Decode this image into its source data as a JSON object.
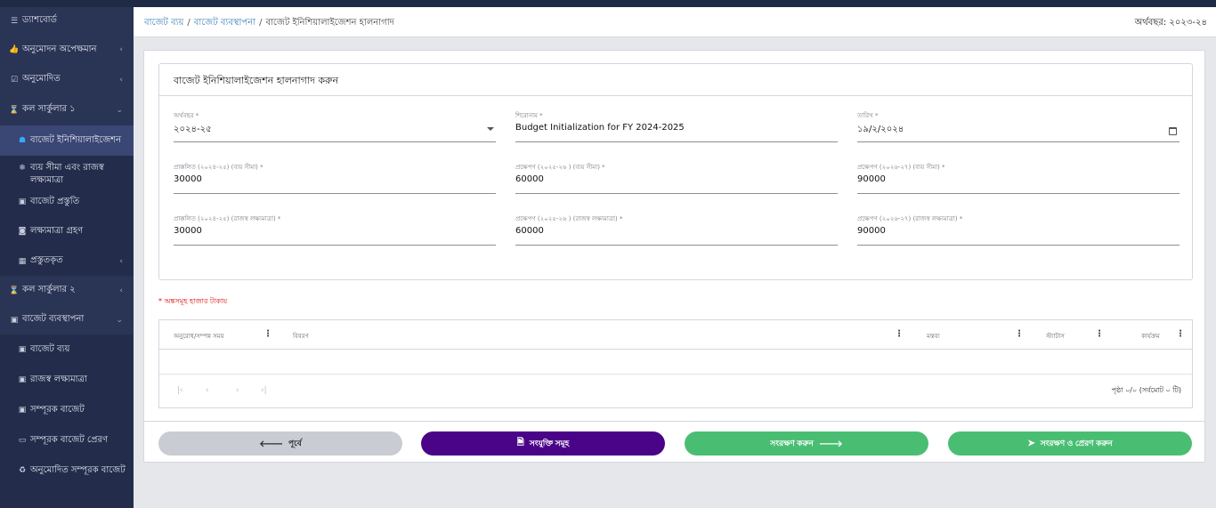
{
  "sidebar": {
    "items": [
      {
        "label": "ড্যাশবোর্ড",
        "icon": "list-icon"
      },
      {
        "label": "অনুমোদন অপেক্ষমান",
        "icon": "thumbs-up-icon"
      },
      {
        "label": "অনুমোদিত",
        "icon": "check-square-icon"
      },
      {
        "label": "কল সার্কুলার ১",
        "icon": "hourglass-icon"
      },
      {
        "label": "বাজেট ইনিশিয়ালাইজেশন",
        "icon": "inbox-icon"
      },
      {
        "label": "ব্যয় সীমা এবং রাজস্ব লক্ষ্যমাত্রা",
        "icon": "snowflake-icon"
      },
      {
        "label": "বাজেট প্রস্তুতি",
        "icon": "briefcase-icon"
      },
      {
        "label": "লক্ষ্যমাত্রা গ্রহণ",
        "icon": "money-icon"
      },
      {
        "label": "প্রস্তুতকৃত",
        "icon": "table-icon"
      },
      {
        "label": "কল সার্কুলার ২",
        "icon": "hourglass-icon"
      },
      {
        "label": "বাজেট ব্যবস্থাপনা",
        "icon": "briefcase-icon"
      },
      {
        "label": "বাজেট ব্যয়",
        "icon": "briefcase-icon"
      },
      {
        "label": "রাজস্ব লক্ষ্যমাত্রা",
        "icon": "briefcase-icon"
      },
      {
        "label": "সম্পূরক বাজেট",
        "icon": "briefcase-icon"
      },
      {
        "label": "সম্পূরক বাজেট প্রেরণ",
        "icon": "credit-card-icon"
      },
      {
        "label": "অনুমোদিত সম্পূরক বাজেট",
        "icon": "recycle-icon"
      }
    ]
  },
  "header": {
    "breadcrumb": [
      "বাজেট ব্যয়",
      "বাজেট ব্যবস্থাপনা",
      "বাজেট ইনিশিয়ালাইজেশন হালনাগাদ"
    ],
    "fiscal_year": "অর্থবছর: ২০২৩-২৪"
  },
  "form": {
    "title": "বাজেট ইনিশিয়ালাইজেশন হালনাগাদ করুন",
    "fields": [
      {
        "label": "অর্থবছর *",
        "value": "২০২৪-২৫"
      },
      {
        "label": "শিরোনাম *",
        "value": "Budget Initialization for FY 2024-2025"
      },
      {
        "label": "তারিখ *",
        "value": "১৯/২/২০২৪"
      },
      {
        "label": "প্রাক্কলিত (২০২৪-২৫) (ব্যয় সীমা) *",
        "value": "30000"
      },
      {
        "label": "প্রক্ষেপণ (২০২৫-২৬ ) (ব্যয় সীমা) *",
        "value": "60000"
      },
      {
        "label": "প্রক্ষেপণ (২০২৬-২৭) (ব্যয় সীমা) *",
        "value": "90000"
      },
      {
        "label": "প্রাক্কলিত (২০২৪-২৫) (রাজস্ব লক্ষ্যমাত্রা) *",
        "value": "30000"
      },
      {
        "label": "প্রক্ষেপণ (২০২৫-২৬ ) (রাজস্ব লক্ষ্যমাত্রা) *",
        "value": "60000"
      },
      {
        "label": "প্রক্ষেপণ (২০২৬-২৭) (রাজস্ব লক্ষ্যমাত্রা) *",
        "value": "90000"
      }
    ]
  },
  "note": "* অঙ্কসমূহ হাজার টাকায়",
  "table": {
    "columns": [
      "অনুরোধ/সম্পন্ন সময়",
      "বিবরণ",
      "মন্তব্য",
      "স্ট্যাটাস",
      "কার্যক্রম"
    ],
    "pagination": {
      "first": "|‹",
      "prev": "‹",
      "next": "›",
      "last": "›|",
      "info": "পৃষ্ঠা ০/০ (সর্বমোট ০ টি)"
    }
  },
  "buttons": {
    "prev": "পূর্বে",
    "attachments": "সংযুক্তি সমূহ",
    "save": "সংরক্ষণ করুন",
    "save_send": "সংরক্ষণ ও প্রেরণ করুন"
  },
  "colors": {
    "sidebar_bg": "#232d4b",
    "primary_purple": "#4a0488",
    "success_green": "#49be72",
    "link_blue": "#3b7fb8",
    "note_red": "#dd1111"
  }
}
